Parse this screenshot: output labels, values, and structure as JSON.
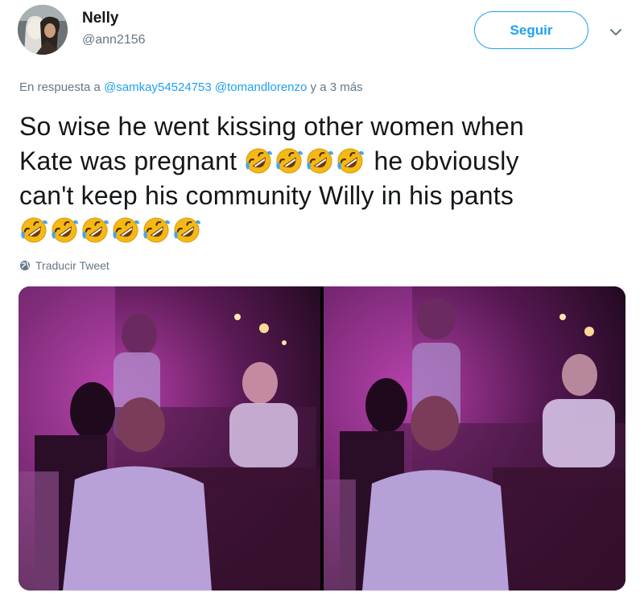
{
  "user": {
    "display_name": "Nelly",
    "handle": "@ann2156",
    "avatar_icon": "avatar-photo"
  },
  "follow_button": {
    "label": "Seguir",
    "color": "#1da1f2"
  },
  "menu": {
    "icon": "chevron-down-icon"
  },
  "reply": {
    "prefix": "En respuesta a",
    "mention1": "@samkay54524753",
    "mention2": "@tomandlorenzo",
    "suffix": "y a 3 más"
  },
  "tweet": {
    "line1": "So wise he went kissing other women when",
    "line2a": "Kate was pregnant",
    "line2b": "he obviously",
    "line3": "can't keep his community Willy in his pants",
    "emoji_name": "rolling-on-floor-laughing"
  },
  "translate": {
    "label": "Traducir Tweet",
    "icon": "globe-icon"
  },
  "media": {
    "photo_count": 2
  }
}
